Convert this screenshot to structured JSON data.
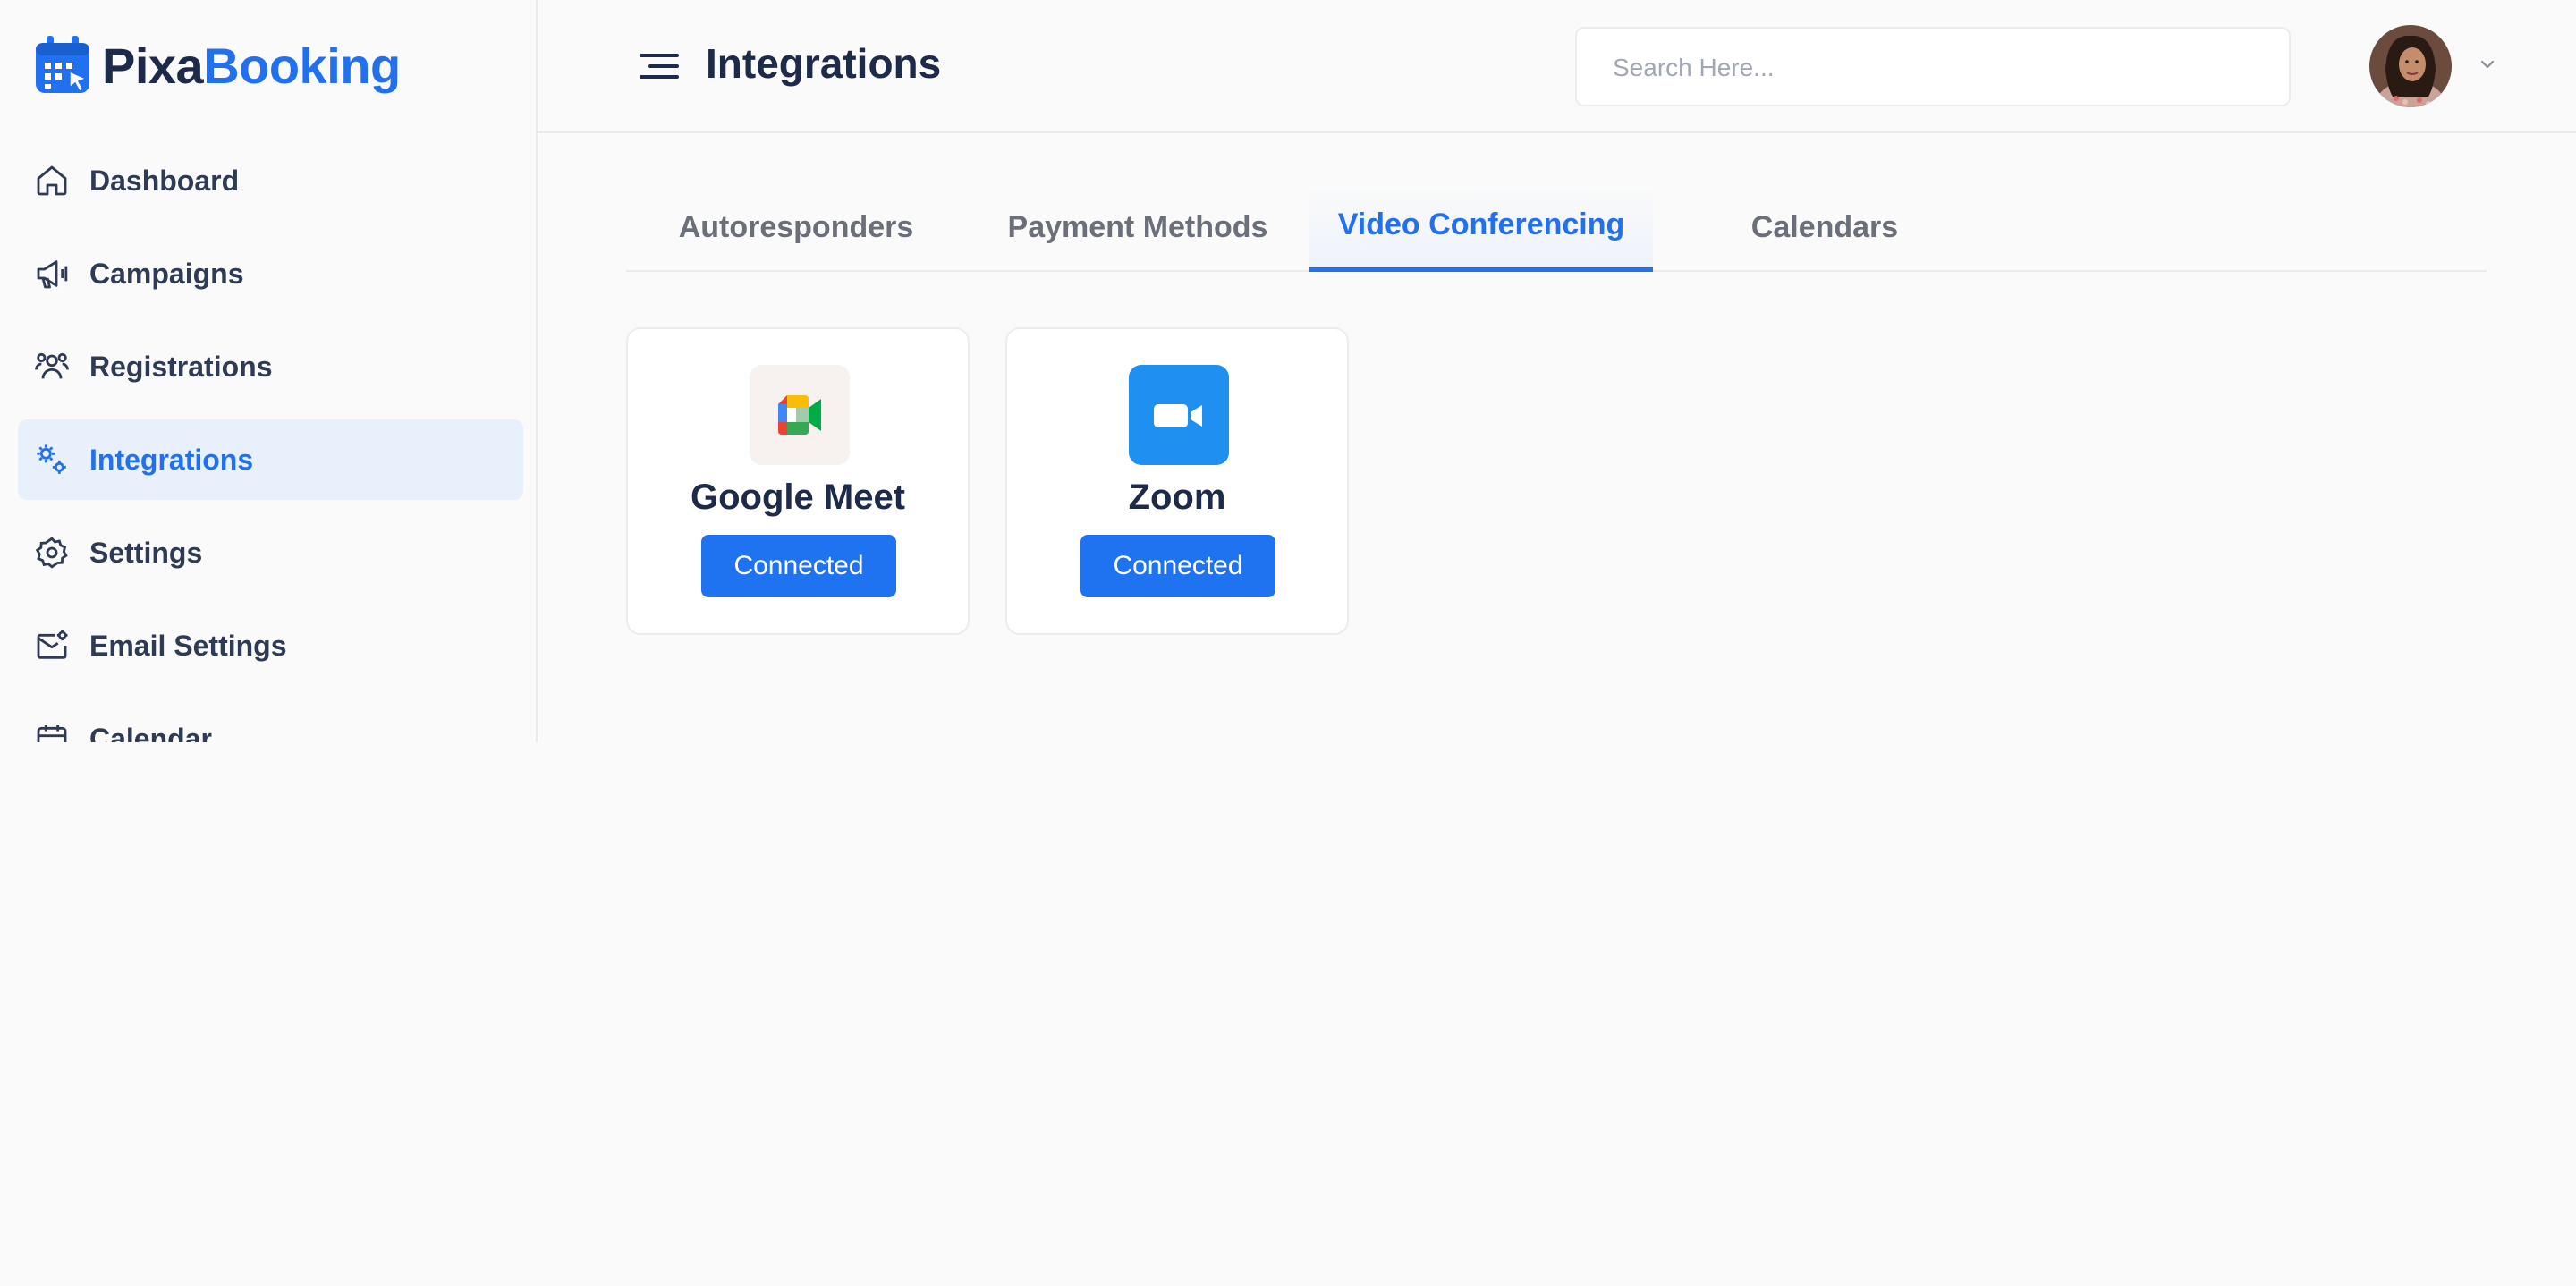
{
  "brand": {
    "name_part1": "Pixa",
    "name_part2": "Booking",
    "primary_color": "#2170f0",
    "text_color": "#1e2a4a"
  },
  "sidebar": {
    "items": [
      {
        "label": "Dashboard",
        "icon": "home-icon",
        "active": false
      },
      {
        "label": "Campaigns",
        "icon": "megaphone-icon",
        "active": false
      },
      {
        "label": "Registrations",
        "icon": "users-icon",
        "active": false
      },
      {
        "label": "Integrations",
        "icon": "integrations-icon",
        "active": true
      },
      {
        "label": "Settings",
        "icon": "gear-icon",
        "active": false
      },
      {
        "label": "Email Settings",
        "icon": "mail-settings-icon",
        "active": false
      },
      {
        "label": "Calendar",
        "icon": "calendar-icon",
        "active": false
      }
    ]
  },
  "header": {
    "title": "Integrations",
    "search_placeholder": "Search Here...",
    "menu_icon": "menu-icon",
    "search_icon": "search-icon",
    "profile_icon": "avatar",
    "dropdown_icon": "chevron-down-icon"
  },
  "tabs": [
    {
      "label": "Autoresponders",
      "active": false
    },
    {
      "label": "Payment Methods",
      "active": false
    },
    {
      "label": "Video Conferencing",
      "active": true
    },
    {
      "label": "Calendars",
      "active": false
    }
  ],
  "integrations": [
    {
      "name": "Google Meet",
      "icon": "google-meet-icon",
      "status": "Connected"
    },
    {
      "name": "Zoom",
      "icon": "zoom-icon",
      "status": "Connected"
    }
  ]
}
